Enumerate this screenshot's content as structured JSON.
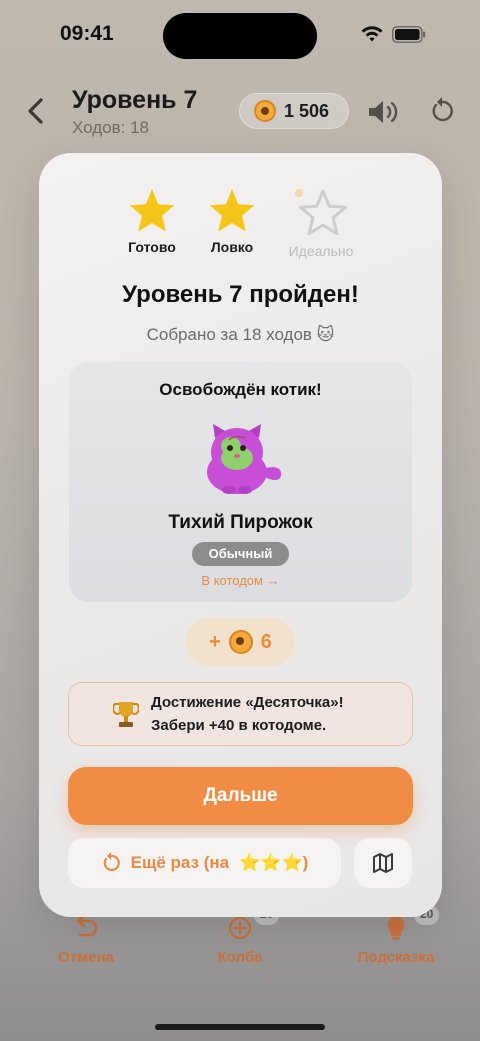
{
  "status_bar": {
    "time": "09:41"
  },
  "header": {
    "title": "Уровень 7",
    "moves": "Ходов: 18",
    "coins": "1 506"
  },
  "toolbar": {
    "undo_label": "Отмена",
    "flask_label": "Колба",
    "hint_label": "Подсказка",
    "hint_cost": "20",
    "flask_cost": "20"
  },
  "modal": {
    "stars": [
      {
        "label": "Готово",
        "earned": true
      },
      {
        "label": "Ловко",
        "earned": true
      },
      {
        "label": "Идеально",
        "earned": false
      }
    ],
    "title": "Уровень 7 пройден!",
    "collected": "Собрано за 18 ходов 🐱",
    "cat_card": {
      "title": "Освобождён котик!",
      "name": "Тихий Пирожок",
      "rarity": "Обычный",
      "link": "В котодом →"
    },
    "reward": {
      "prefix": "+",
      "amount": "6"
    },
    "achievement": {
      "line1": "Достижение «Десяточка»!",
      "line2": "Забери +40 в котодоме."
    },
    "next_button": "Дальше",
    "retry_button": "Ещё раз (на",
    "retry_suffix": "⭐⭐⭐)"
  },
  "colors": {
    "accent": "#f18c45",
    "star": "#f5c518",
    "rarity_badge": "#8c8c8f"
  }
}
